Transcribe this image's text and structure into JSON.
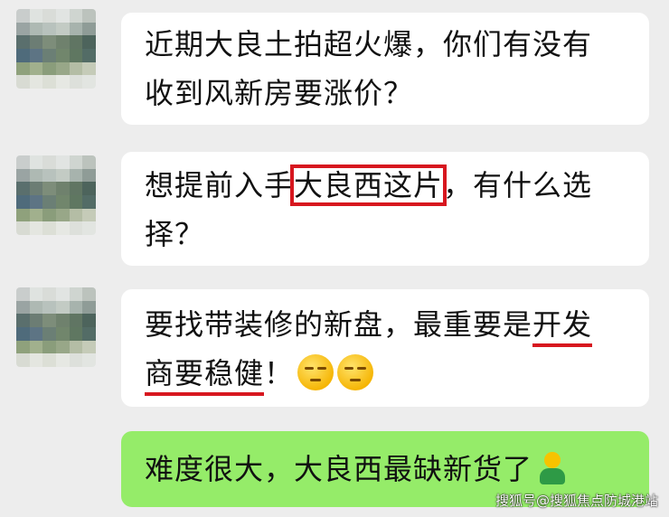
{
  "messages": [
    {
      "lines": [
        "近期大良土拍超火爆，你们有没有",
        "收到风新房要涨价？"
      ]
    },
    {
      "line1_before": "想提前入手",
      "line1_boxed": "大良西这片",
      "line1_after": "，有什么选",
      "line2": "择？"
    },
    {
      "line1_before": "要找带装修的新盘，最重要是",
      "line1_underlined": "开发",
      "line2_underlined": "商要稳健",
      "line2_after": "！"
    }
  ],
  "reply": {
    "text": "难度很大，大良西最缺新货了"
  },
  "watermark": "搜狐号@搜狐焦点防城港站",
  "colors": {
    "bg": "#ededed",
    "bubble": "#ffffff",
    "reply_bubble": "#95ec69",
    "mark": "#d7171f"
  },
  "icons": [
    "pixelated-avatar",
    "smirk-emoji-icon",
    "person-emoji-icon"
  ]
}
